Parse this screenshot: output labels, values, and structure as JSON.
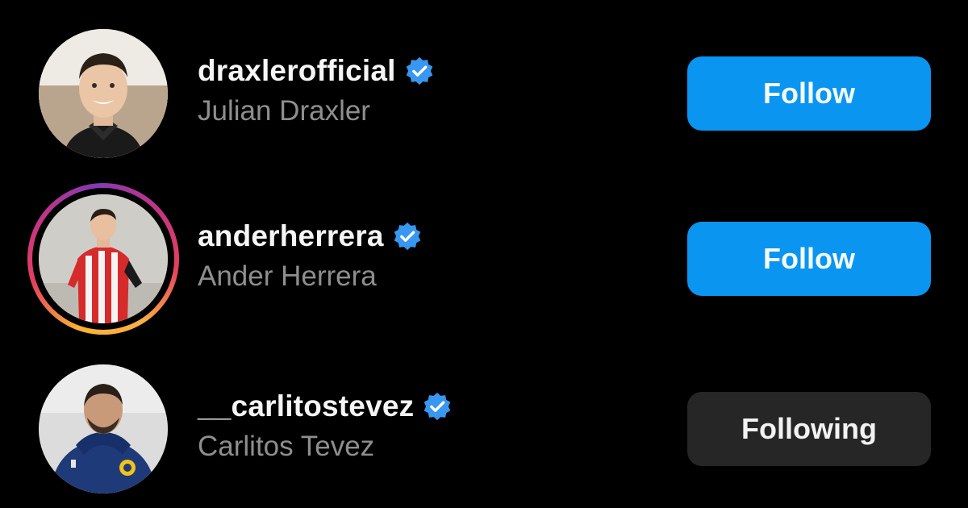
{
  "accounts": [
    {
      "username": "draxlerofficial",
      "full_name": "Julian Draxler",
      "verified": true,
      "has_story_ring": false,
      "button_label": "Follow",
      "button_state": "follow"
    },
    {
      "username": "anderherrera",
      "full_name": "Ander Herrera",
      "verified": true,
      "has_story_ring": true,
      "button_label": "Follow",
      "button_state": "follow"
    },
    {
      "username": "__carlitostevez",
      "full_name": "Carlitos Tevez",
      "verified": true,
      "has_story_ring": false,
      "button_label": "Following",
      "button_state": "following"
    }
  ],
  "colors": {
    "background": "#000000",
    "follow_button": "#0a95f0",
    "following_button": "#262626",
    "verified_badge": "#3897f0",
    "secondary_text": "#8e8e8e"
  },
  "icons": {
    "verified": "verified-badge-icon"
  }
}
